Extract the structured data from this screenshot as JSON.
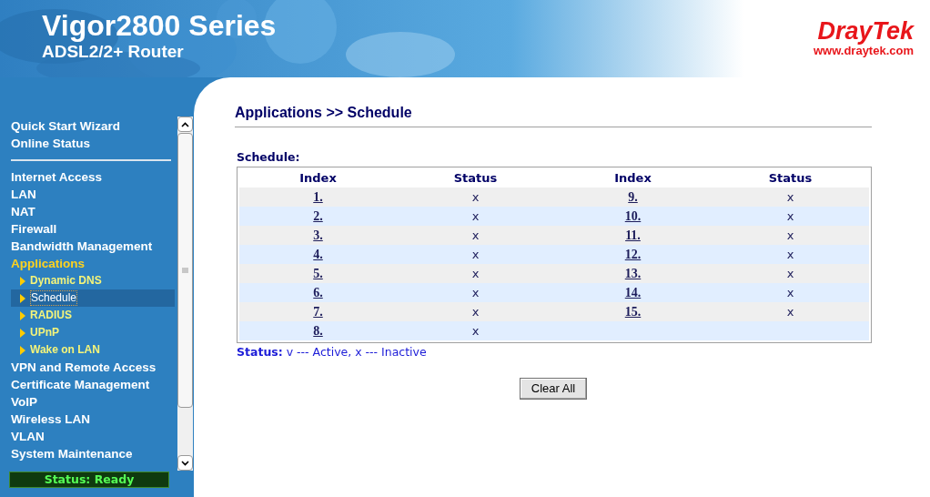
{
  "header": {
    "title": "Vigor2800 Series",
    "subtitle": "ADSL2/2+ Router",
    "logo": "DrayTek",
    "logo_url": "www.draytek.com"
  },
  "sidebar": {
    "groups": [
      [
        {
          "label": "Quick Start Wizard",
          "selected": false
        },
        {
          "label": "Online Status",
          "selected": false
        }
      ],
      [
        {
          "label": "Internet Access",
          "selected": false
        },
        {
          "label": "LAN",
          "selected": false
        },
        {
          "label": "NAT",
          "selected": false
        },
        {
          "label": "Firewall",
          "selected": false
        },
        {
          "label": "Bandwidth Management",
          "selected": false
        },
        {
          "label": "Applications",
          "selected": true,
          "children": [
            {
              "label": "Dynamic DNS",
              "selected": false
            },
            {
              "label": "Schedule",
              "selected": true
            },
            {
              "label": "RADIUS",
              "selected": false
            },
            {
              "label": "UPnP",
              "selected": false
            },
            {
              "label": "Wake on LAN",
              "selected": false
            }
          ]
        },
        {
          "label": "VPN and Remote Access",
          "selected": false
        },
        {
          "label": "Certificate Management",
          "selected": false
        },
        {
          "label": "VoIP",
          "selected": false
        },
        {
          "label": "Wireless LAN",
          "selected": false
        },
        {
          "label": "VLAN",
          "selected": false
        },
        {
          "label": "System Maintenance",
          "selected": false
        }
      ]
    ],
    "status": "Status: Ready"
  },
  "page": {
    "title": "Applications >> Schedule",
    "table_caption": "Schedule:",
    "table": {
      "columns": [
        "Index",
        "Status",
        "Index",
        "Status"
      ],
      "rows": [
        [
          "1.",
          "x",
          "9.",
          "x"
        ],
        [
          "2.",
          "x",
          "10.",
          "x"
        ],
        [
          "3.",
          "x",
          "11.",
          "x"
        ],
        [
          "4.",
          "x",
          "12.",
          "x"
        ],
        [
          "5.",
          "x",
          "13.",
          "x"
        ],
        [
          "6.",
          "x",
          "14.",
          "x"
        ],
        [
          "7.",
          "x",
          "15.",
          "x"
        ],
        [
          "8.",
          "x"
        ]
      ]
    },
    "legend": "**Status:** v --- Active, x --- Inactive",
    "buttons": [
      "Clear All"
    ]
  }
}
